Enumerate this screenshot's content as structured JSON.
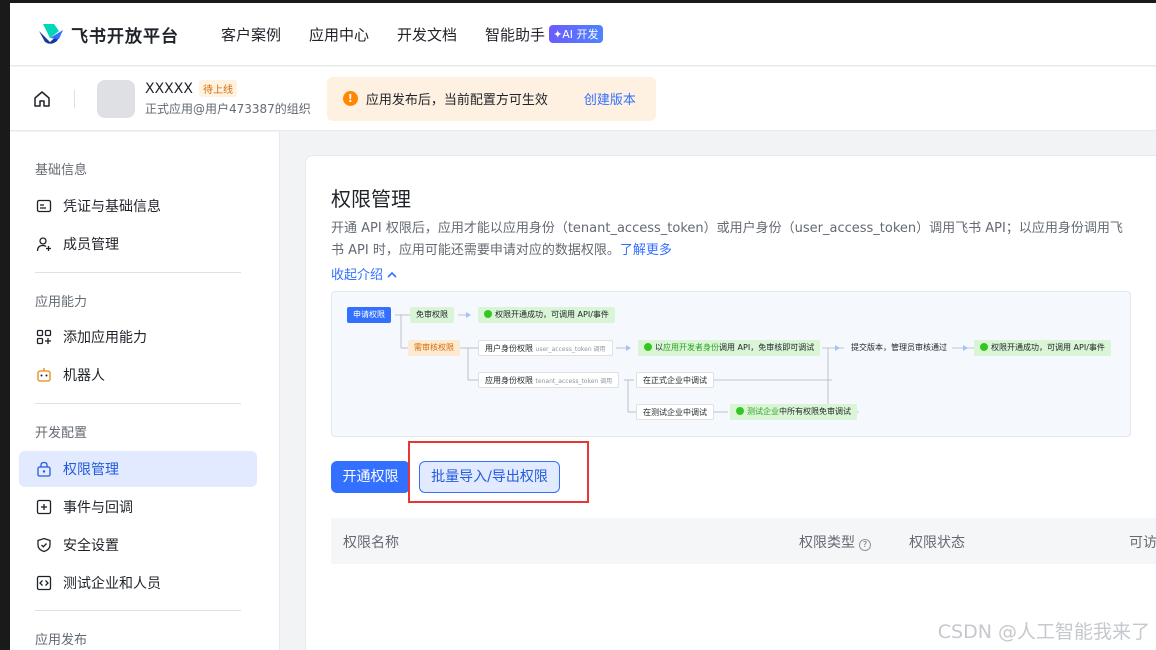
{
  "nav": {
    "brand": "飞书开放平台",
    "links": [
      "客户案例",
      "应用中心",
      "开发文档",
      "智能助手"
    ],
    "ai_badge": "✦AI 开发"
  },
  "app": {
    "name": "XXXXX",
    "status": "待上线",
    "subtitle": "正式应用@用户473387的组织",
    "notice_text": "应用发布后，当前配置方可生效",
    "notice_link": "创建版本"
  },
  "sidebar": {
    "groups": [
      "基础信息",
      "应用能力",
      "开发配置",
      "应用发布"
    ],
    "items": [
      {
        "label": "凭证与基础信息",
        "icon": "credential-icon"
      },
      {
        "label": "成员管理",
        "icon": "member-add-icon"
      },
      {
        "label": "添加应用能力",
        "icon": "grid-add-icon"
      },
      {
        "label": "机器人",
        "icon": "robot-icon"
      },
      {
        "label": "权限管理",
        "icon": "lock-icon"
      },
      {
        "label": "事件与回调",
        "icon": "event-icon"
      },
      {
        "label": "安全设置",
        "icon": "shield-icon"
      },
      {
        "label": "测试企业和人员",
        "icon": "code-icon"
      }
    ]
  },
  "main": {
    "title": "权限管理",
    "description": "开通 API 权限后，应用才能以应用身份（tenant_access_token）或用户身份（user_access_token）调用飞书 API；以应用身份调用飞书 API 时，应用可能还需要申请对应的数据权限。",
    "learn_more": "了解更多",
    "collapse": "收起介绍",
    "flow": {
      "apply": "申请权限",
      "free": "免审权限",
      "free_result": "权限开通成功，可调用 API/事件",
      "review": "需审核权限",
      "user_perm": "用户身份权限",
      "user_token": "user_access_token 调用",
      "dev_free_prefix": "以",
      "dev_free_hl": "应用开发者身份",
      "dev_free_suffix": "调用 API，免审核即可调试",
      "submit": "提交版本，管理员审核通过",
      "final_result": "权限开通成功，可调用 API/事件",
      "app_perm": "应用身份权限",
      "tenant_token": "tenant_access_token 调用",
      "prod_debug": "在正式企业中调试",
      "test_debug": "在测试企业中调试",
      "test_free_hl": "测试企业",
      "test_free_suffix": "中所有权限免审调试"
    },
    "btn_enable": "开通权限",
    "btn_batch": "批量导入/导出权限",
    "table_headers": [
      "权限名称",
      "权限类型",
      "权限状态",
      "可访"
    ]
  },
  "watermark": "CSDN @人工智能我来了"
}
